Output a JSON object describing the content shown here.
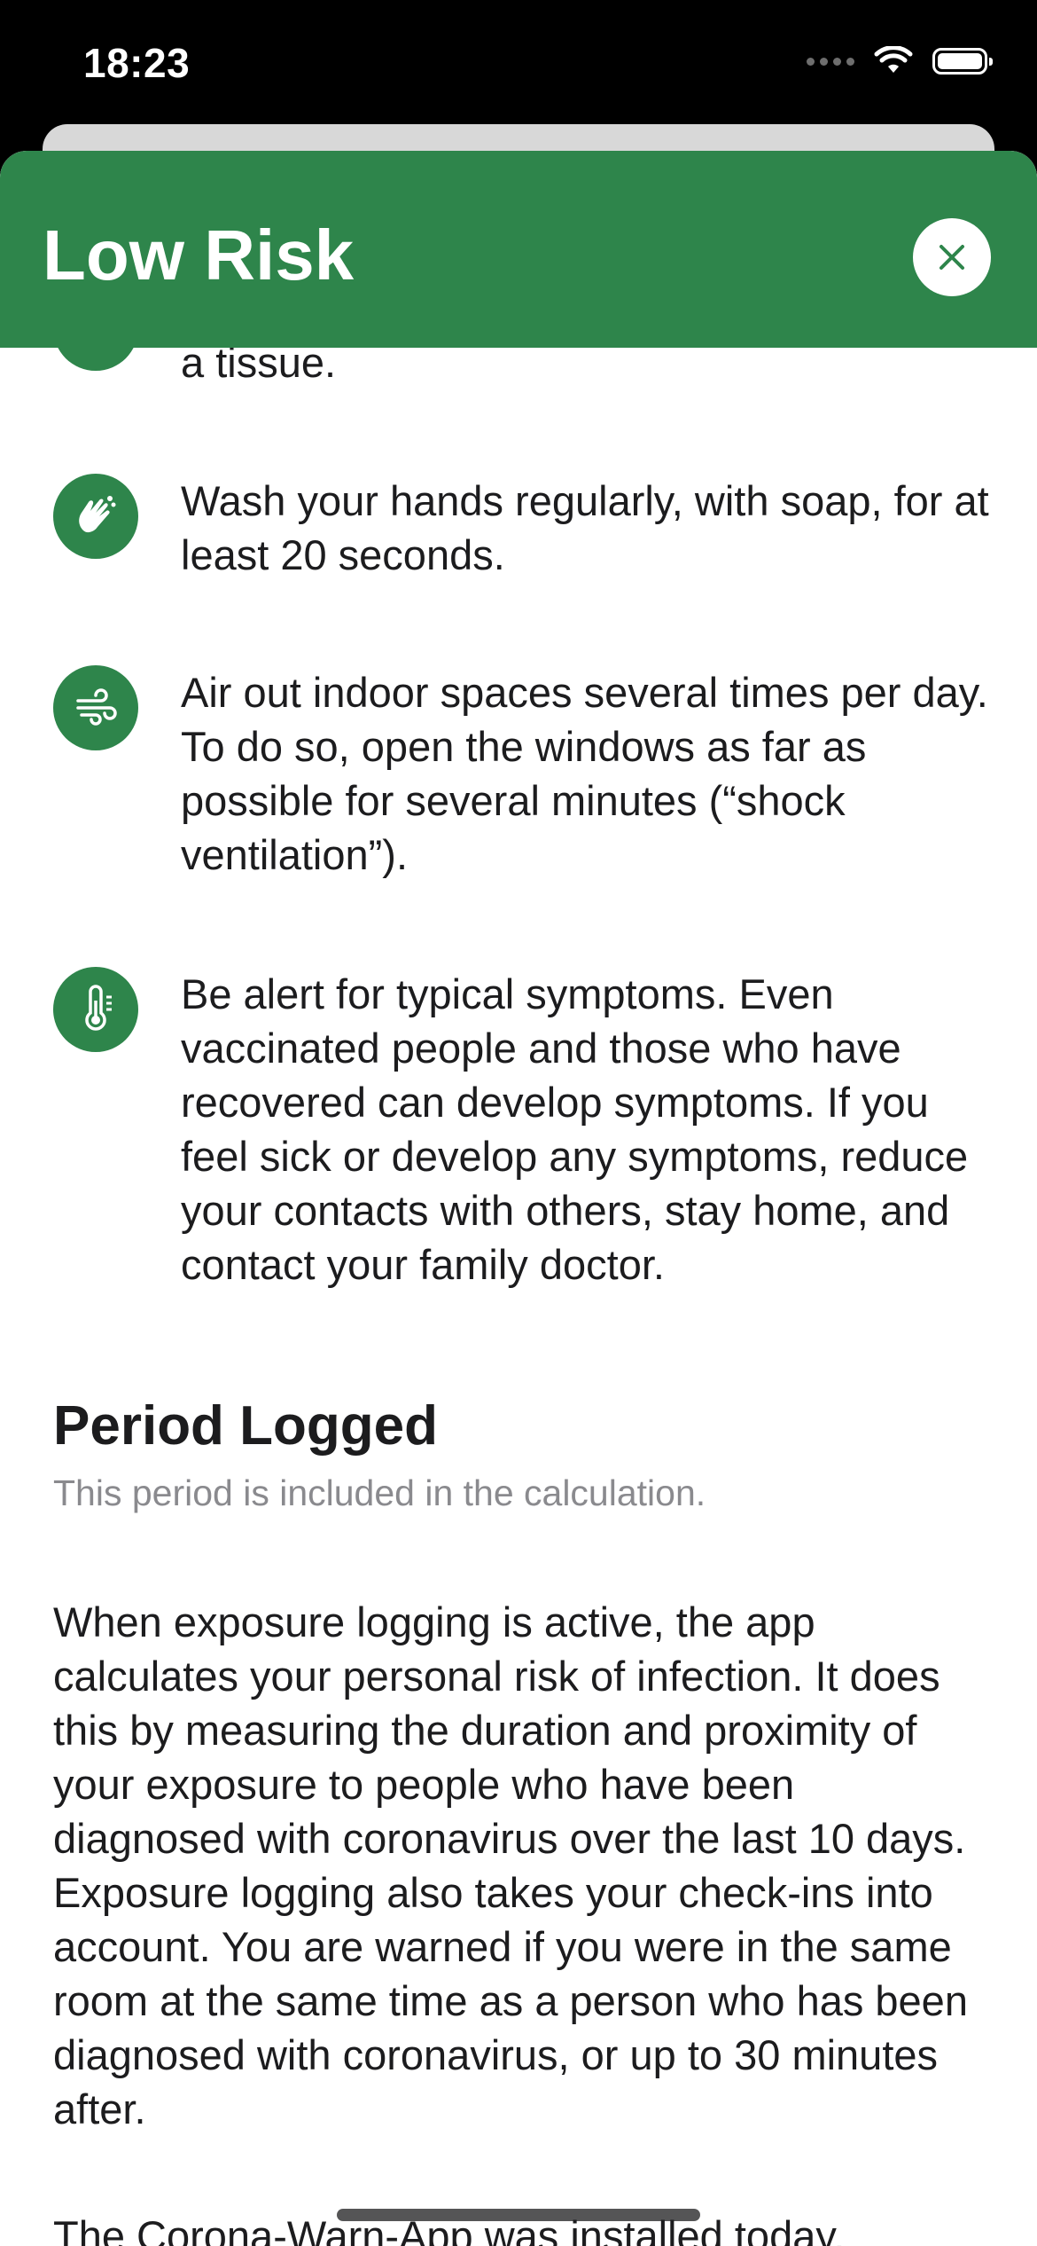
{
  "status_bar": {
    "time": "18:23"
  },
  "header": {
    "title": "Low Risk",
    "close_icon": "close-icon"
  },
  "tips": [
    {
      "icon": "tissue-icon",
      "text": "a tissue."
    },
    {
      "icon": "hand-wash-icon",
      "text": "Wash your hands regularly, with soap, for at least 20 seconds."
    },
    {
      "icon": "wind-icon",
      "text": "Air out indoor spaces several times per day. To do so, open the windows as far as possible for several minutes (“shock ventilation”)."
    },
    {
      "icon": "thermometer-icon",
      "text": "Be alert for typical symptoms. Even vaccinated people and those who have recovered can develop symptoms. If you feel sick or develop any symptoms, reduce your contacts with others, stay home, and contact your family doctor."
    }
  ],
  "period_section": {
    "title": "Period Logged",
    "subtitle": "This period is included in the calculation.",
    "paragraph1": "When exposure logging is active, the app calculates your personal risk of infection. It does this by measuring the duration and proximity of your exposure to people who have been diagnosed with coronavirus over the last 10 days. Exposure logging also takes your check-ins into account. You are warned if you were in the same room at the same time as a person who has been diagnosed with coronavirus, or up to 30 minutes after.",
    "paragraph2": "The Corona-Warn-App was installed today."
  },
  "colors": {
    "accent": "#2e854b",
    "text": "#1c1c1e",
    "secondary_text": "#8a8a8e"
  }
}
